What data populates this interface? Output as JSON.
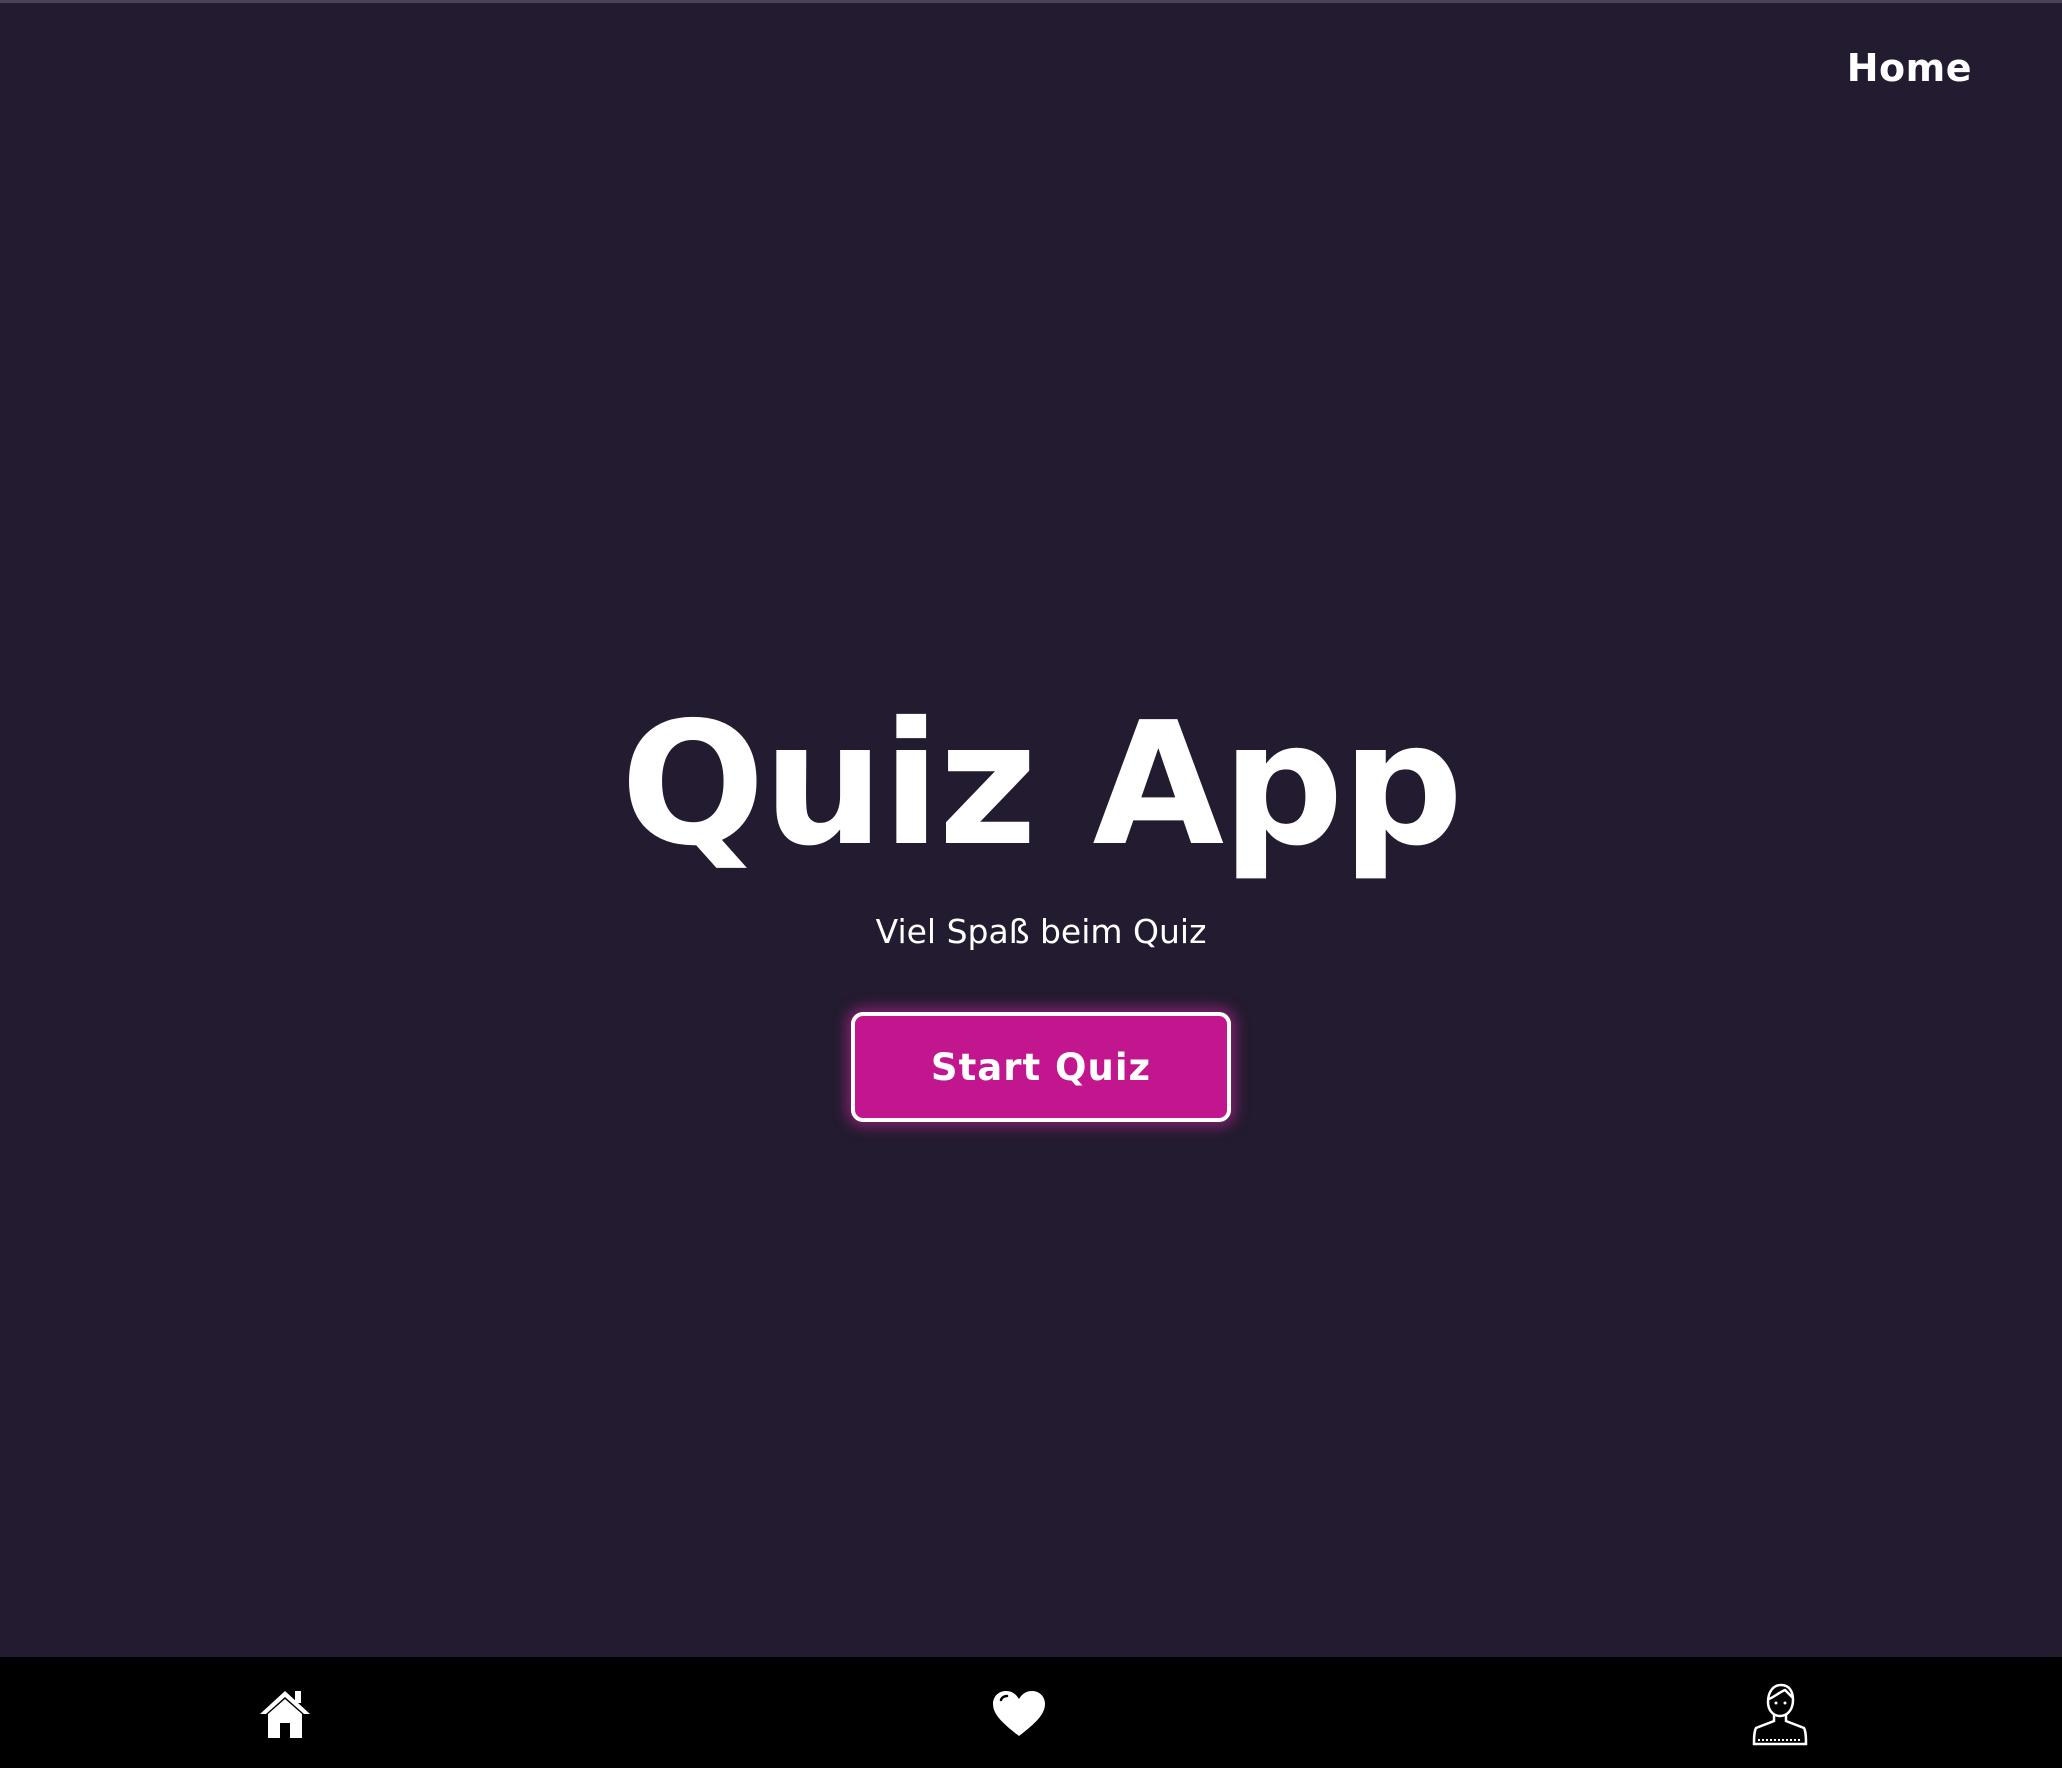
{
  "header": {
    "home_link": "Home"
  },
  "hero": {
    "title": "Quiz App",
    "subtitle": "Viel Spaß beim Quiz",
    "start_button": "Start Quiz"
  },
  "bottom_nav": {
    "items": [
      {
        "icon": "home-icon"
      },
      {
        "icon": "heart-icon"
      },
      {
        "icon": "user-icon"
      }
    ]
  },
  "colors": {
    "background": "#231b2f",
    "accent": "#c2168f",
    "nav_background": "#000000",
    "text": "#ffffff"
  }
}
